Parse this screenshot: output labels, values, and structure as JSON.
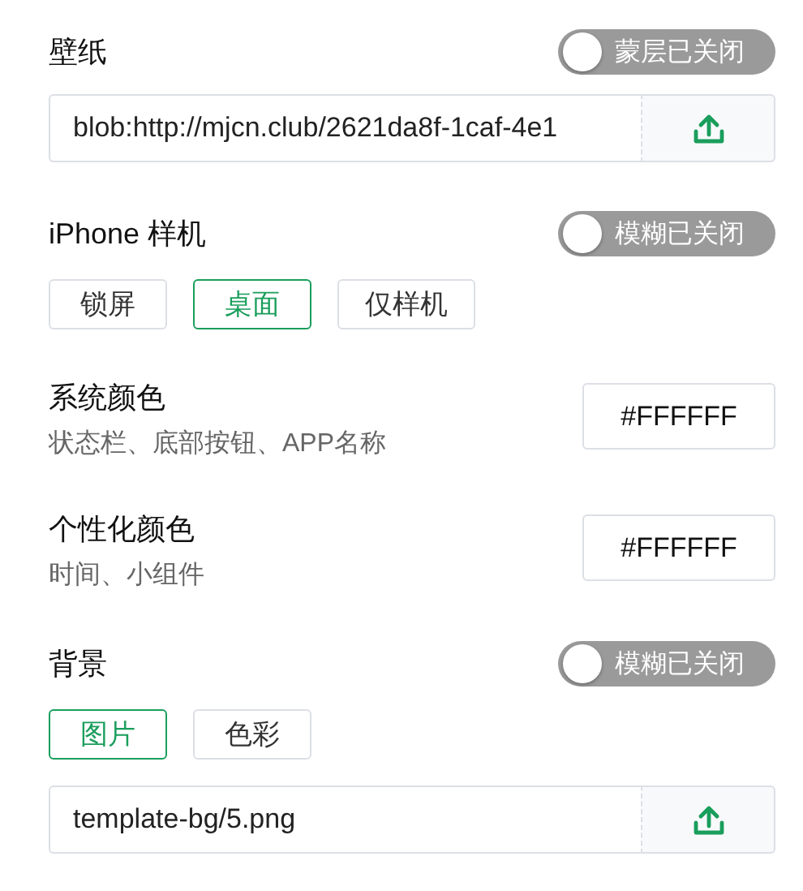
{
  "sections": [
    {
      "kind": "upload",
      "title": "壁纸",
      "toggle": {
        "label": "蒙层已关闭",
        "on": false
      },
      "field": {
        "value": "blob:http://mjcn.club/2621da8f-1caf-4e1"
      }
    },
    {
      "kind": "choice",
      "title": "iPhone 样机",
      "toggle": {
        "label": "模糊已关闭",
        "on": false
      },
      "options": [
        {
          "label": "锁屏",
          "selected": false
        },
        {
          "label": "桌面",
          "selected": true
        },
        {
          "label": "仅样机",
          "selected": false
        }
      ]
    },
    {
      "kind": "color",
      "title": "系统颜色",
      "subtitle": "状态栏、底部按钮、APP名称",
      "value": "#FFFFFF"
    },
    {
      "kind": "color",
      "title": "个性化颜色",
      "subtitle": "时间、小组件",
      "value": "#FFFFFF"
    },
    {
      "kind": "choice",
      "title": "背景",
      "toggle": {
        "label": "模糊已关闭",
        "on": false
      },
      "options": [
        {
          "label": "图片",
          "selected": true
        },
        {
          "label": "色彩",
          "selected": false
        }
      ],
      "field": {
        "value": "template-bg/5.png"
      }
    }
  ]
}
